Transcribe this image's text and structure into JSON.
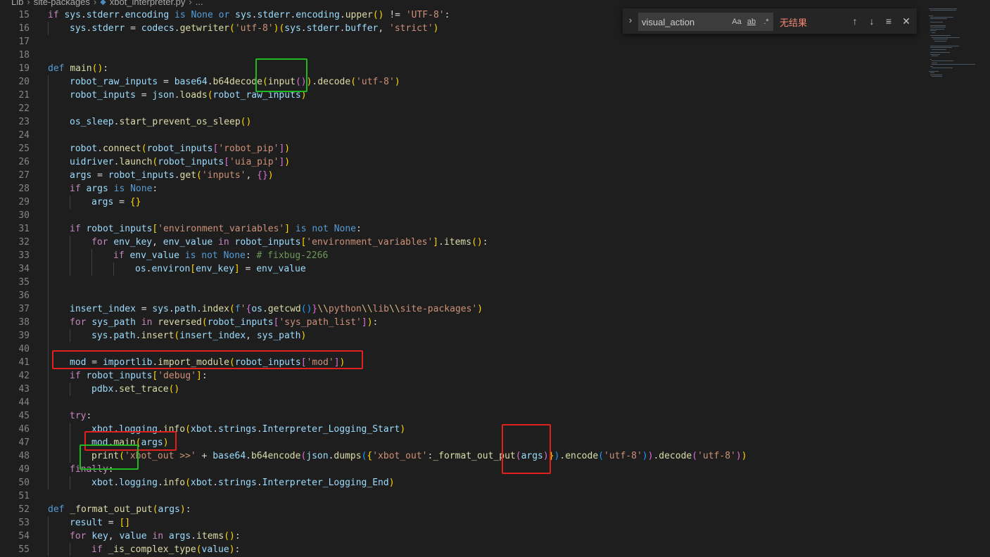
{
  "breadcrumb": {
    "items": [
      "Lib",
      "site-packages",
      "xbot_interpreter.py",
      "..."
    ]
  },
  "find": {
    "value": "visual_action",
    "match_case": "Aa",
    "whole_word": "ab",
    "regex": ".*",
    "status": "无结果",
    "prev_icon": "↑",
    "next_icon": "↓",
    "selection_icon": "≡",
    "close_icon": "✕"
  },
  "code": [
    {
      "n": "15",
      "indent": 0,
      "t": [
        [
          "kw",
          "if "
        ],
        [
          "var",
          "sys"
        ],
        [
          "op",
          "."
        ],
        [
          "var",
          "stderr"
        ],
        [
          "op",
          "."
        ],
        [
          "var",
          "encoding"
        ],
        [
          "kwb",
          " is "
        ],
        [
          "kwb",
          "None"
        ],
        [
          "kwb",
          " or "
        ],
        [
          "var",
          "sys"
        ],
        [
          "op",
          "."
        ],
        [
          "var",
          "stderr"
        ],
        [
          "op",
          "."
        ],
        [
          "var",
          "encoding"
        ],
        [
          "op",
          "."
        ],
        [
          "fn",
          "upper"
        ],
        [
          "br1",
          "()"
        ],
        [
          "op",
          " != "
        ],
        [
          "str",
          "'UTF-8'"
        ],
        [
          "op",
          ":"
        ]
      ]
    },
    {
      "n": "16",
      "indent": 1,
      "t": [
        [
          "var",
          "sys"
        ],
        [
          "op",
          "."
        ],
        [
          "var",
          "stderr"
        ],
        [
          "op",
          " = "
        ],
        [
          "var",
          "codecs"
        ],
        [
          "op",
          "."
        ],
        [
          "fn",
          "getwriter"
        ],
        [
          "br1",
          "("
        ],
        [
          "str",
          "'utf-8'"
        ],
        [
          "br1",
          ")"
        ],
        [
          "br1",
          "("
        ],
        [
          "var",
          "sys"
        ],
        [
          "op",
          "."
        ],
        [
          "var",
          "stderr"
        ],
        [
          "op",
          "."
        ],
        [
          "var",
          "buffer"
        ],
        [
          "op",
          ", "
        ],
        [
          "str",
          "'strict'"
        ],
        [
          "br1",
          ")"
        ]
      ]
    },
    {
      "n": "17",
      "indent": 0,
      "t": []
    },
    {
      "n": "18",
      "indent": 0,
      "t": []
    },
    {
      "n": "19",
      "indent": 0,
      "t": [
        [
          "kwb",
          "def "
        ],
        [
          "fn",
          "main"
        ],
        [
          "br1",
          "()"
        ],
        [
          "op",
          ":"
        ]
      ]
    },
    {
      "n": "20",
      "indent": 1,
      "t": [
        [
          "var",
          "robot_raw_inputs"
        ],
        [
          "op",
          " = "
        ],
        [
          "var",
          "base64"
        ],
        [
          "op",
          "."
        ],
        [
          "fn",
          "b64decode"
        ],
        [
          "br1",
          "("
        ],
        [
          "fn",
          "input"
        ],
        [
          "br2",
          "()"
        ],
        [
          "br1",
          ")"
        ],
        [
          "op",
          "."
        ],
        [
          "fn",
          "decode"
        ],
        [
          "br1",
          "("
        ],
        [
          "str",
          "'utf-8'"
        ],
        [
          "br1",
          ")"
        ]
      ]
    },
    {
      "n": "21",
      "indent": 1,
      "t": [
        [
          "var",
          "robot_inputs"
        ],
        [
          "op",
          " = "
        ],
        [
          "var",
          "json"
        ],
        [
          "op",
          "."
        ],
        [
          "fn",
          "loads"
        ],
        [
          "br1",
          "("
        ],
        [
          "var",
          "robot_raw_inputs"
        ],
        [
          "br1",
          ")"
        ]
      ]
    },
    {
      "n": "22",
      "indent": 1,
      "t": []
    },
    {
      "n": "23",
      "indent": 1,
      "t": [
        [
          "var",
          "os_sleep"
        ],
        [
          "op",
          "."
        ],
        [
          "fn",
          "start_prevent_os_sleep"
        ],
        [
          "br1",
          "()"
        ]
      ]
    },
    {
      "n": "24",
      "indent": 1,
      "t": []
    },
    {
      "n": "25",
      "indent": 1,
      "t": [
        [
          "var",
          "robot"
        ],
        [
          "op",
          "."
        ],
        [
          "fn",
          "connect"
        ],
        [
          "br1",
          "("
        ],
        [
          "var",
          "robot_inputs"
        ],
        [
          "br2",
          "["
        ],
        [
          "str",
          "'robot_pip'"
        ],
        [
          "br2",
          "]"
        ],
        [
          "br1",
          ")"
        ]
      ]
    },
    {
      "n": "26",
      "indent": 1,
      "t": [
        [
          "var",
          "uidriver"
        ],
        [
          "op",
          "."
        ],
        [
          "fn",
          "launch"
        ],
        [
          "br1",
          "("
        ],
        [
          "var",
          "robot_inputs"
        ],
        [
          "br2",
          "["
        ],
        [
          "str",
          "'uia_pip'"
        ],
        [
          "br2",
          "]"
        ],
        [
          "br1",
          ")"
        ]
      ]
    },
    {
      "n": "27",
      "indent": 1,
      "t": [
        [
          "var",
          "args"
        ],
        [
          "op",
          " = "
        ],
        [
          "var",
          "robot_inputs"
        ],
        [
          "op",
          "."
        ],
        [
          "fn",
          "get"
        ],
        [
          "br1",
          "("
        ],
        [
          "str",
          "'inputs'"
        ],
        [
          "op",
          ", "
        ],
        [
          "br2",
          "{}"
        ],
        [
          "br1",
          ")"
        ]
      ]
    },
    {
      "n": "28",
      "indent": 1,
      "t": [
        [
          "kw",
          "if "
        ],
        [
          "var",
          "args"
        ],
        [
          "kwb",
          " is "
        ],
        [
          "kwb",
          "None"
        ],
        [
          "op",
          ":"
        ]
      ]
    },
    {
      "n": "29",
      "indent": 2,
      "t": [
        [
          "var",
          "args"
        ],
        [
          "op",
          " = "
        ],
        [
          "br1",
          "{}"
        ]
      ]
    },
    {
      "n": "30",
      "indent": 1,
      "t": []
    },
    {
      "n": "31",
      "indent": 1,
      "t": [
        [
          "kw",
          "if "
        ],
        [
          "var",
          "robot_inputs"
        ],
        [
          "br1",
          "["
        ],
        [
          "str",
          "'environment_variables'"
        ],
        [
          "br1",
          "]"
        ],
        [
          "kwb",
          " is not "
        ],
        [
          "kwb",
          "None"
        ],
        [
          "op",
          ":"
        ]
      ]
    },
    {
      "n": "32",
      "indent": 2,
      "t": [
        [
          "kw",
          "for "
        ],
        [
          "var",
          "env_key"
        ],
        [
          "op",
          ", "
        ],
        [
          "var",
          "env_value"
        ],
        [
          "kw",
          " in "
        ],
        [
          "var",
          "robot_inputs"
        ],
        [
          "br1",
          "["
        ],
        [
          "str",
          "'environment_variables'"
        ],
        [
          "br1",
          "]"
        ],
        [
          "op",
          "."
        ],
        [
          "fn",
          "items"
        ],
        [
          "br1",
          "()"
        ],
        [
          "op",
          ":"
        ]
      ]
    },
    {
      "n": "33",
      "indent": 3,
      "t": [
        [
          "kw",
          "if "
        ],
        [
          "var",
          "env_value"
        ],
        [
          "kwb",
          " is not "
        ],
        [
          "kwb",
          "None"
        ],
        [
          "op",
          ": "
        ],
        [
          "cmt",
          "# fixbug-2266"
        ]
      ]
    },
    {
      "n": "34",
      "indent": 4,
      "t": [
        [
          "var",
          "os"
        ],
        [
          "op",
          "."
        ],
        [
          "var",
          "environ"
        ],
        [
          "br1",
          "["
        ],
        [
          "var",
          "env_key"
        ],
        [
          "br1",
          "]"
        ],
        [
          "op",
          " = "
        ],
        [
          "var",
          "env_value"
        ]
      ]
    },
    {
      "n": "35",
      "indent": 1,
      "t": []
    },
    {
      "n": "36",
      "indent": 1,
      "t": []
    },
    {
      "n": "37",
      "indent": 1,
      "t": [
        [
          "var",
          "insert_index"
        ],
        [
          "op",
          " = "
        ],
        [
          "var",
          "sys"
        ],
        [
          "op",
          "."
        ],
        [
          "var",
          "path"
        ],
        [
          "op",
          "."
        ],
        [
          "fn",
          "index"
        ],
        [
          "br1",
          "("
        ],
        [
          "kwb",
          "f"
        ],
        [
          "str",
          "'"
        ],
        [
          "br2",
          "{"
        ],
        [
          "var",
          "os"
        ],
        [
          "op",
          "."
        ],
        [
          "fn",
          "getcwd"
        ],
        [
          "br3",
          "()"
        ],
        [
          "br2",
          "}"
        ],
        [
          "esc",
          "\\\\"
        ],
        [
          "str",
          "python"
        ],
        [
          "esc",
          "\\\\"
        ],
        [
          "str",
          "lib"
        ],
        [
          "esc",
          "\\\\"
        ],
        [
          "str",
          "site-packages'"
        ],
        [
          "br1",
          ")"
        ]
      ]
    },
    {
      "n": "38",
      "indent": 1,
      "t": [
        [
          "kw",
          "for "
        ],
        [
          "var",
          "sys_path"
        ],
        [
          "kw",
          " in "
        ],
        [
          "fn",
          "reversed"
        ],
        [
          "br1",
          "("
        ],
        [
          "var",
          "robot_inputs"
        ],
        [
          "br2",
          "["
        ],
        [
          "str",
          "'sys_path_list'"
        ],
        [
          "br2",
          "]"
        ],
        [
          "br1",
          ")"
        ],
        [
          "op",
          ":"
        ]
      ]
    },
    {
      "n": "39",
      "indent": 2,
      "t": [
        [
          "var",
          "sys"
        ],
        [
          "op",
          "."
        ],
        [
          "var",
          "path"
        ],
        [
          "op",
          "."
        ],
        [
          "fn",
          "insert"
        ],
        [
          "br1",
          "("
        ],
        [
          "var",
          "insert_index"
        ],
        [
          "op",
          ", "
        ],
        [
          "var",
          "sys_path"
        ],
        [
          "br1",
          ")"
        ]
      ]
    },
    {
      "n": "40",
      "indent": 1,
      "t": []
    },
    {
      "n": "41",
      "indent": 1,
      "t": [
        [
          "var",
          "mod"
        ],
        [
          "op",
          " = "
        ],
        [
          "var",
          "importlib"
        ],
        [
          "op",
          "."
        ],
        [
          "fn",
          "import_module"
        ],
        [
          "br1",
          "("
        ],
        [
          "var",
          "robot_inputs"
        ],
        [
          "br2",
          "["
        ],
        [
          "str",
          "'mod'"
        ],
        [
          "br2",
          "]"
        ],
        [
          "br1",
          ")"
        ]
      ]
    },
    {
      "n": "42",
      "indent": 1,
      "t": [
        [
          "kw",
          "if "
        ],
        [
          "var",
          "robot_inputs"
        ],
        [
          "br1",
          "["
        ],
        [
          "str",
          "'debug'"
        ],
        [
          "br1",
          "]"
        ],
        [
          "op",
          ":"
        ]
      ]
    },
    {
      "n": "43",
      "indent": 2,
      "t": [
        [
          "var",
          "pdbx"
        ],
        [
          "op",
          "."
        ],
        [
          "fn",
          "set_trace"
        ],
        [
          "br1",
          "()"
        ]
      ]
    },
    {
      "n": "44",
      "indent": 1,
      "t": []
    },
    {
      "n": "45",
      "indent": 1,
      "t": [
        [
          "kw",
          "try"
        ],
        [
          "op",
          ":"
        ]
      ]
    },
    {
      "n": "46",
      "indent": 2,
      "t": [
        [
          "var",
          "xbot"
        ],
        [
          "op",
          "."
        ],
        [
          "var",
          "logging"
        ],
        [
          "op",
          "."
        ],
        [
          "fn",
          "info"
        ],
        [
          "br1",
          "("
        ],
        [
          "var",
          "xbot"
        ],
        [
          "op",
          "."
        ],
        [
          "var",
          "strings"
        ],
        [
          "op",
          "."
        ],
        [
          "var",
          "Interpreter_Logging_Start"
        ],
        [
          "br1",
          ")"
        ]
      ]
    },
    {
      "n": "47",
      "indent": 2,
      "t": [
        [
          "var",
          "mod"
        ],
        [
          "op",
          "."
        ],
        [
          "fn",
          "main"
        ],
        [
          "br1",
          "("
        ],
        [
          "var",
          "args"
        ],
        [
          "br1",
          ")"
        ]
      ]
    },
    {
      "n": "48",
      "indent": 2,
      "t": [
        [
          "fn",
          "print"
        ],
        [
          "br1",
          "("
        ],
        [
          "str",
          "'xbot_out >>'"
        ],
        [
          "op",
          " + "
        ],
        [
          "var",
          "base64"
        ],
        [
          "op",
          "."
        ],
        [
          "fn",
          "b64encode"
        ],
        [
          "br2",
          "("
        ],
        [
          "var",
          "json"
        ],
        [
          "op",
          "."
        ],
        [
          "fn",
          "dumps"
        ],
        [
          "br3",
          "("
        ],
        [
          "br1",
          "{"
        ],
        [
          "str",
          "'xbot_out'"
        ],
        [
          "op",
          ":"
        ],
        [
          "fn",
          "_format_out_put"
        ],
        [
          "br2",
          "("
        ],
        [
          "var",
          "args"
        ],
        [
          "br2",
          ")"
        ],
        [
          "br1",
          "}"
        ],
        [
          "br3",
          ")"
        ],
        [
          "op",
          "."
        ],
        [
          "fn",
          "encode"
        ],
        [
          "br3",
          "("
        ],
        [
          "str",
          "'utf-8'"
        ],
        [
          "br3",
          ")"
        ],
        [
          "br2",
          ")"
        ],
        [
          "op",
          "."
        ],
        [
          "fn",
          "decode"
        ],
        [
          "br2",
          "("
        ],
        [
          "str",
          "'utf-8'"
        ],
        [
          "br2",
          ")"
        ],
        [
          "br1",
          ")"
        ]
      ]
    },
    {
      "n": "49",
      "indent": 1,
      "t": [
        [
          "kw",
          "finally"
        ],
        [
          "op",
          ":"
        ]
      ]
    },
    {
      "n": "50",
      "indent": 2,
      "t": [
        [
          "var",
          "xbot"
        ],
        [
          "op",
          "."
        ],
        [
          "var",
          "logging"
        ],
        [
          "op",
          "."
        ],
        [
          "fn",
          "info"
        ],
        [
          "br1",
          "("
        ],
        [
          "var",
          "xbot"
        ],
        [
          "op",
          "."
        ],
        [
          "var",
          "strings"
        ],
        [
          "op",
          "."
        ],
        [
          "var",
          "Interpreter_Logging_End"
        ],
        [
          "br1",
          ")"
        ]
      ]
    },
    {
      "n": "51",
      "indent": 0,
      "t": []
    },
    {
      "n": "52",
      "indent": 0,
      "t": [
        [
          "kwb",
          "def "
        ],
        [
          "fn",
          "_format_out_put"
        ],
        [
          "br1",
          "("
        ],
        [
          "var",
          "args"
        ],
        [
          "br1",
          ")"
        ],
        [
          "op",
          ":"
        ]
      ]
    },
    {
      "n": "53",
      "indent": 1,
      "t": [
        [
          "var",
          "result"
        ],
        [
          "op",
          " = "
        ],
        [
          "br1",
          "[]"
        ]
      ]
    },
    {
      "n": "54",
      "indent": 1,
      "t": [
        [
          "kw",
          "for "
        ],
        [
          "var",
          "key"
        ],
        [
          "op",
          ", "
        ],
        [
          "var",
          "value"
        ],
        [
          "kw",
          " in "
        ],
        [
          "var",
          "args"
        ],
        [
          "op",
          "."
        ],
        [
          "fn",
          "items"
        ],
        [
          "br1",
          "()"
        ],
        [
          "op",
          ":"
        ]
      ]
    },
    {
      "n": "55",
      "indent": 2,
      "t": [
        [
          "kw",
          "if "
        ],
        [
          "fn",
          "_is_complex_type"
        ],
        [
          "br1",
          "("
        ],
        [
          "var",
          "value"
        ],
        [
          "br1",
          ")"
        ],
        [
          "op",
          ":"
        ]
      ]
    }
  ],
  "colors": {
    "background": "#1e1e1e",
    "highlight_green": "#1fb81f",
    "highlight_red": "#e0201c"
  }
}
